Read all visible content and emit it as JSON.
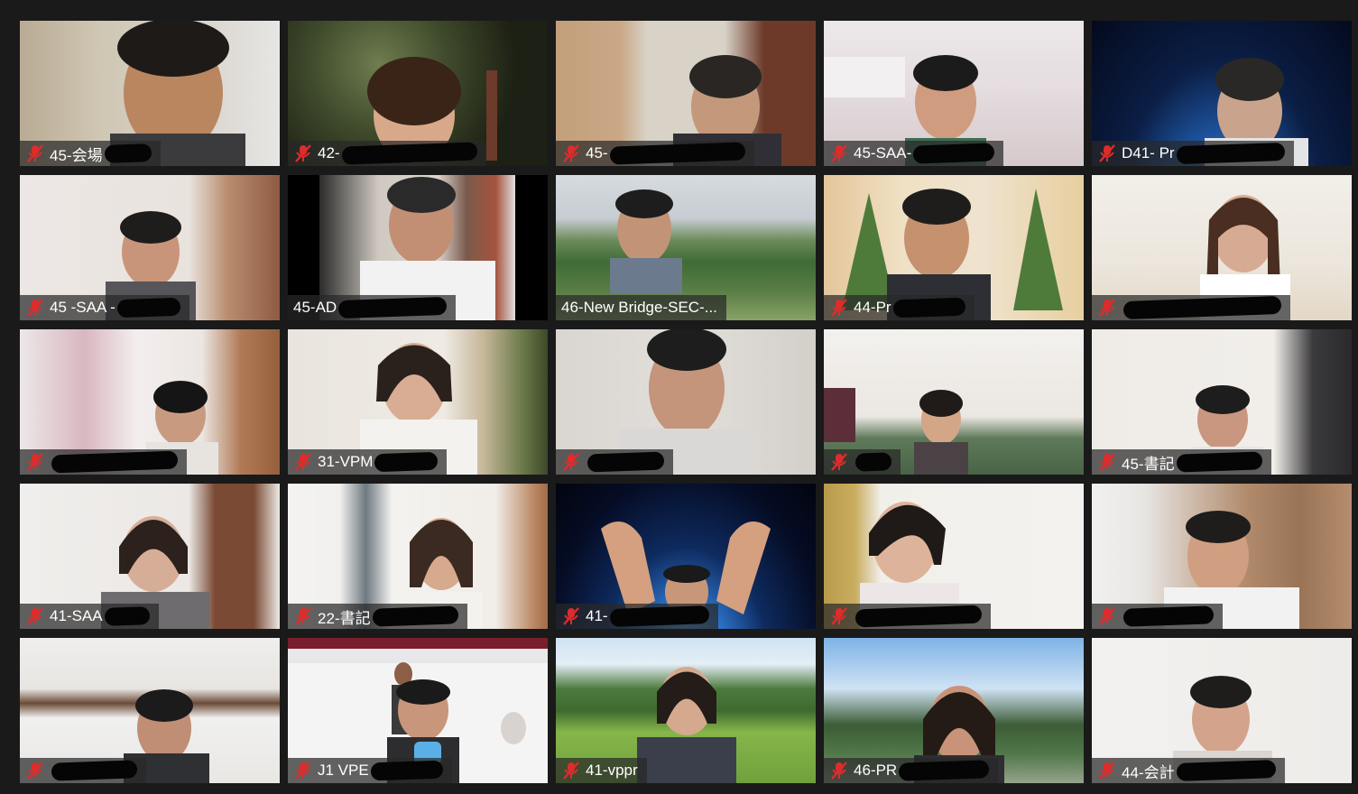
{
  "meeting": {
    "participants": [
      {
        "label": "45-会場",
        "muted": true
      },
      {
        "label": "42-",
        "muted": true
      },
      {
        "label": "45-",
        "muted": true
      },
      {
        "label": "45-SAA-",
        "muted": true
      },
      {
        "label": "D41- Pr",
        "muted": true
      },
      {
        "label": "45 -SAA -",
        "muted": true
      },
      {
        "label": "45-AD",
        "muted": false
      },
      {
        "label": "46-New Bridge-SEC-...",
        "muted": false
      },
      {
        "label": "44-Pr",
        "muted": true
      },
      {
        "label": "",
        "muted": true
      },
      {
        "label": "",
        "muted": true
      },
      {
        "label": "31-VPM",
        "muted": true
      },
      {
        "label": "",
        "muted": true
      },
      {
        "label": "",
        "muted": true
      },
      {
        "label": "45-書記",
        "muted": true
      },
      {
        "label": "41-SAA",
        "muted": true
      },
      {
        "label": "22-書記",
        "muted": true
      },
      {
        "label": "41-",
        "muted": true
      },
      {
        "label": "",
        "muted": true
      },
      {
        "label": "",
        "muted": true
      },
      {
        "label": "",
        "muted": true
      },
      {
        "label": "J1 VPE",
        "muted": true
      },
      {
        "label": "41-vppr",
        "muted": true
      },
      {
        "label": "46-PR",
        "muted": true
      },
      {
        "label": "44-会計",
        "muted": true
      }
    ]
  },
  "colors": {
    "background": "#1a1a1a",
    "label_bg": "#282828",
    "muted_icon": "#e02b2b",
    "label_text": "#ffffff"
  }
}
